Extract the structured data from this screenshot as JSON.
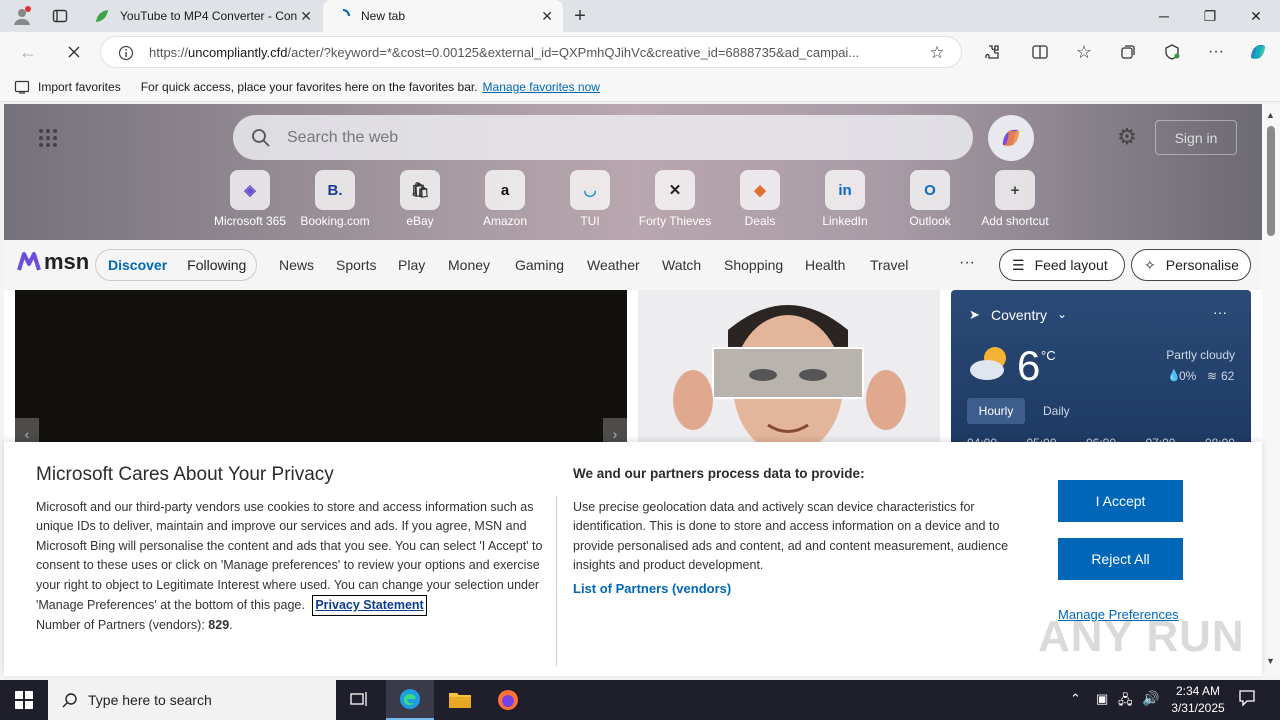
{
  "tabs": [
    {
      "label": "YouTube to MP4 Converter - Con",
      "active": false
    },
    {
      "label": "New tab",
      "active": true
    }
  ],
  "address": {
    "url_prefix": "https://",
    "url_domain": "uncompliantly.cfd",
    "url_rest": "/acter/?keyword=*&cost=0.00125&external_id=QXPmhQJihVc&creative_id=6888735&ad_campai..."
  },
  "favorites_bar": {
    "import_label": "Import favorites",
    "message": "For quick access, place your favorites here on the favorites bar.",
    "manage_link": "Manage favorites now"
  },
  "newtab": {
    "search_placeholder": "Search the web",
    "sign_in": "Sign in",
    "shortcuts": [
      {
        "label": "Microsoft 365",
        "glyph": "◈",
        "color": "#6a4fc9"
      },
      {
        "label": "Booking.com",
        "glyph": "B.",
        "color": "#1d3f8f"
      },
      {
        "label": "eBay",
        "glyph": "🛍",
        "color": "#333"
      },
      {
        "label": "Amazon",
        "glyph": "a",
        "color": "#111"
      },
      {
        "label": "TUI",
        "glyph": "◡",
        "color": "#1e8fd6"
      },
      {
        "label": "Forty Thieves",
        "glyph": "✕",
        "color": "#222"
      },
      {
        "label": "Deals",
        "glyph": "◆",
        "color": "#e07030"
      },
      {
        "label": "LinkedIn",
        "glyph": "in",
        "color": "#0a66c2"
      },
      {
        "label": "Outlook",
        "glyph": "O",
        "color": "#0f6cbd"
      },
      {
        "label": "Add shortcut",
        "glyph": "+",
        "color": "#444"
      }
    ]
  },
  "msn": {
    "logo": "msn",
    "pills": [
      "Discover",
      "Following"
    ],
    "nav": [
      "News",
      "Sports",
      "Play",
      "Money",
      "Gaming",
      "Weather",
      "Watch",
      "Shopping",
      "Health",
      "Travel"
    ],
    "more": "···",
    "feed_layout": "Feed layout",
    "personalise": "Personalise"
  },
  "weather": {
    "location": "Coventry",
    "temp": "6",
    "unit": "°C",
    "condition": "Partly cloudy",
    "precip": "0%",
    "aqi": "62",
    "tabs": [
      "Hourly",
      "Daily"
    ],
    "hours": [
      "04:00",
      "05:00",
      "06:00",
      "07:00",
      "08:00"
    ]
  },
  "privacy": {
    "title": "Microsoft Cares About Your Privacy",
    "body": "Microsoft and our third-party vendors use cookies to store and access information such as unique IDs to deliver, maintain and improve our services and ads. If you agree, MSN and Microsoft Bing will personalise the content and ads that you see. You can select 'I Accept' to consent to these uses or click on 'Manage preferences' to review your options and exercise your right to object to Legitimate Interest where used.  You can change your selection under 'Manage Preferences' at the bottom of this page.",
    "privacy_link": "Privacy Statement",
    "partners_label": "Number of Partners (vendors):",
    "partners_count": "829",
    "partners_period": ".",
    "right_title": "We and our partners process data to provide:",
    "right_body": "Use precise geolocation data and actively scan device characteristics for identification. This is done to store and access information on a device and to provide personalised ads and content, ad and content measurement, audience insights and product development.",
    "vendors_link": "List of Partners (vendors)",
    "accept": "I Accept",
    "reject": "Reject All",
    "manage": "Manage Preferences"
  },
  "taskbar": {
    "search_placeholder": "Type here to search",
    "time": "2:34 AM",
    "date": "3/31/2025"
  },
  "watermark": "ANY RUN"
}
